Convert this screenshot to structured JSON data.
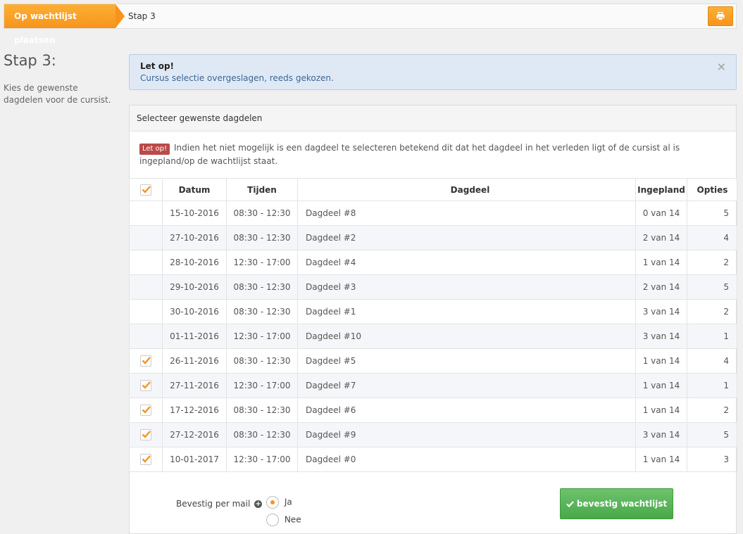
{
  "breadcrumb": {
    "active": "Op wachtlijst plaatsen",
    "current": "Stap 3"
  },
  "step": {
    "title": "Stap 3:",
    "description": "Kies de gewenste dagdelen voor de cursist."
  },
  "alert": {
    "title": "Let op!",
    "text": "Cursus selectie overgeslagen, reeds gekozen.",
    "close": "×"
  },
  "panel": {
    "title": "Selecteer gewenste dagdelen",
    "notice_badge": "Let op!",
    "notice_text": "Indien het niet mogelijk is een dagdeel te selecteren betekend dit dat het dagdeel in het verleden ligt of de cursist al is ingepland/op de wachtlijst staat."
  },
  "table": {
    "headers": {
      "date": "Datum",
      "time": "Tijden",
      "part": "Dagdeel",
      "planned": "Ingepland",
      "options": "Opties"
    },
    "header_checked": true,
    "rows": [
      {
        "checkbox": false,
        "checked": false,
        "date": "15-10-2016",
        "time": "08:30 - 12:30",
        "part": "Dagdeel #8",
        "planned": "0 van 14",
        "options": "5"
      },
      {
        "checkbox": false,
        "checked": false,
        "date": "27-10-2016",
        "time": "08:30 - 12:30",
        "part": "Dagdeel #2",
        "planned": "2 van 14",
        "options": "4"
      },
      {
        "checkbox": false,
        "checked": false,
        "date": "28-10-2016",
        "time": "12:30 - 17:00",
        "part": "Dagdeel #4",
        "planned": "1 van 14",
        "options": "2"
      },
      {
        "checkbox": false,
        "checked": false,
        "date": "29-10-2016",
        "time": "08:30 - 12:30",
        "part": "Dagdeel #3",
        "planned": "2 van 14",
        "options": "5"
      },
      {
        "checkbox": false,
        "checked": false,
        "date": "30-10-2016",
        "time": "08:30 - 12:30",
        "part": "Dagdeel #1",
        "planned": "3 van 14",
        "options": "2"
      },
      {
        "checkbox": false,
        "checked": false,
        "date": "01-11-2016",
        "time": "12:30 - 17:00",
        "part": "Dagdeel #10",
        "planned": "3 van 14",
        "options": "1"
      },
      {
        "checkbox": true,
        "checked": true,
        "date": "26-11-2016",
        "time": "08:30 - 12:30",
        "part": "Dagdeel #5",
        "planned": "1 van 14",
        "options": "4"
      },
      {
        "checkbox": true,
        "checked": true,
        "date": "27-11-2016",
        "time": "12:30 - 17:00",
        "part": "Dagdeel #7",
        "planned": "1 van 14",
        "options": "1"
      },
      {
        "checkbox": true,
        "checked": true,
        "date": "17-12-2016",
        "time": "08:30 - 12:30",
        "part": "Dagdeel #6",
        "planned": "1 van 14",
        "options": "2"
      },
      {
        "checkbox": true,
        "checked": true,
        "date": "27-12-2016",
        "time": "08:30 - 12:30",
        "part": "Dagdeel #9",
        "planned": "3 van 14",
        "options": "5"
      },
      {
        "checkbox": true,
        "checked": true,
        "date": "10-01-2017",
        "time": "12:30 - 17:00",
        "part": "Dagdeel #0",
        "planned": "1 van 14",
        "options": "3"
      }
    ]
  },
  "form": {
    "mail_label": "Bevestig per mail",
    "options": [
      {
        "label": "Ja",
        "selected": true
      },
      {
        "label": "Nee",
        "selected": false
      }
    ],
    "confirm_label": "bevestig wachtlijst"
  },
  "colors": {
    "accent": "#f7941d",
    "success": "#49a849",
    "danger": "#b94a48"
  }
}
